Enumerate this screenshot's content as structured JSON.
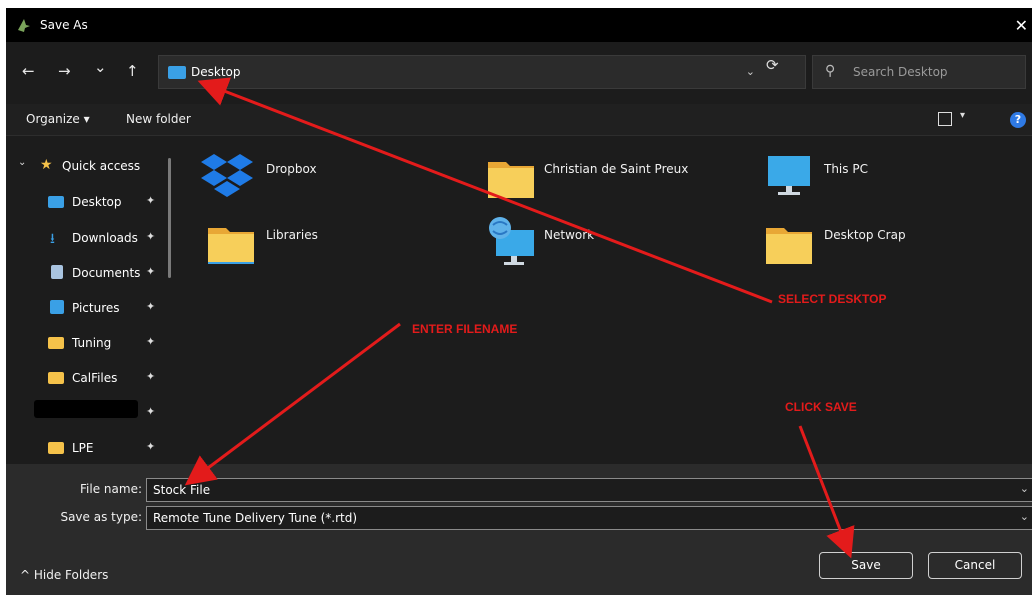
{
  "window": {
    "title": "Save As",
    "close": "✕"
  },
  "nav": {
    "back": "←",
    "forward": "→",
    "recent": "⌄",
    "up": "↑",
    "refresh": "⟳"
  },
  "address": {
    "folder": "Desktop",
    "dropdown": "⌄"
  },
  "search": {
    "placeholder": "Search Desktop",
    "icon": "⚲"
  },
  "toolbar": {
    "organize": "Organize ▾",
    "new_folder": "New folder",
    "view_chevron": "▾",
    "help": "?"
  },
  "sidebar": {
    "quick_access": "Quick access",
    "items": [
      {
        "label": "Desktop",
        "color": "#3aa0e6"
      },
      {
        "label": "Downloads",
        "color": "#3aa0e6"
      },
      {
        "label": "Documents",
        "color": "#a9c4e0"
      },
      {
        "label": "Pictures",
        "color": "#3aa0e6"
      },
      {
        "label": "Tuning",
        "color": "#f5c24a"
      },
      {
        "label": "CalFiles",
        "color": "#f5c24a"
      },
      {
        "label": "",
        "color": "#000000"
      },
      {
        "label": "LPE",
        "color": "#f5c24a"
      }
    ],
    "pin": "📌"
  },
  "files": [
    {
      "label": "Dropbox",
      "icon": "dropbox-icon"
    },
    {
      "label": "Christian de Saint Preux",
      "icon": "folder-icon"
    },
    {
      "label": "This PC",
      "icon": "pc-icon"
    },
    {
      "label": "Libraries",
      "icon": "folder-icon"
    },
    {
      "label": "Network",
      "icon": "network-icon"
    },
    {
      "label": "Desktop Crap",
      "icon": "folder-icon"
    }
  ],
  "form": {
    "file_name_label": "File name:",
    "file_name_value": "Stock File",
    "type_label": "Save as type:",
    "type_value": "Remote Tune Delivery Tune (*.rtd)"
  },
  "footer": {
    "hide_folders": "^  Hide Folders",
    "save": "Save",
    "cancel": "Cancel"
  },
  "annotations": {
    "select_desktop": "SELECT DESKTOP",
    "enter_filename": "ENTER FILENAME",
    "click_save": "CLICK SAVE"
  },
  "colors": {
    "annotation": "#e31b1b",
    "folder": "#f5c24a",
    "accent": "#3aa0e6"
  }
}
